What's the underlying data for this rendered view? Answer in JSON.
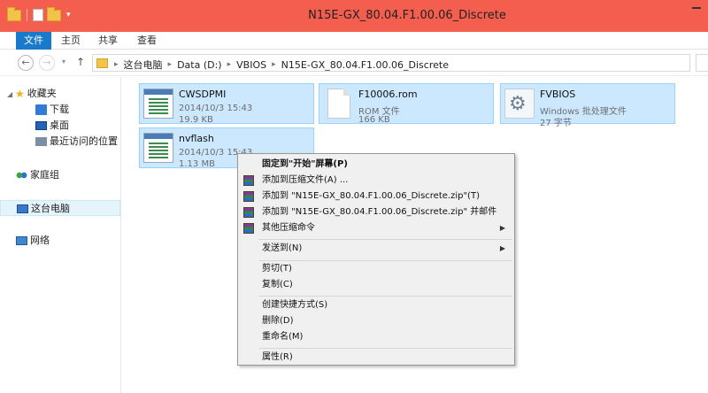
{
  "window": {
    "title": "N15E-GX_80.04.F1.00.06_Discrete"
  },
  "ribbon": {
    "tabs": [
      {
        "label": "文件",
        "active": true
      },
      {
        "label": "主页"
      },
      {
        "label": "共享"
      },
      {
        "label": "查看"
      }
    ]
  },
  "address": {
    "crumbs": [
      "这台电脑",
      "Data (D:)",
      "VBIOS",
      "N15E-GX_80.04.F1.00.06_Discrete"
    ]
  },
  "sidebar": {
    "favorites": "收藏夹",
    "downloads": "下载",
    "desktop": "桌面",
    "recent": "最近访问的位置",
    "homegroup": "家庭组",
    "this_pc": "这台电脑",
    "network": "网络"
  },
  "files": [
    {
      "name": "CWSDPMI",
      "line1": "2014/10/3 15:43",
      "line2": "19.9 KB",
      "icon": "exe-icon"
    },
    {
      "name": "F10006.rom",
      "line1": "ROM 文件",
      "line2": "166 KB",
      "icon": "rom-file-icon"
    },
    {
      "name": "FVBIOS",
      "line1": "Windows 批处理文件",
      "line2": "27 字节",
      "icon": "batch-file-icon"
    },
    {
      "name": "nvflash",
      "line1": "2014/10/3 15:43",
      "line2": "1.13 MB",
      "icon": "exe-icon"
    }
  ],
  "context_menu": {
    "items": [
      {
        "label": "固定到\"开始\"屏幕(P)",
        "bold": true
      },
      {
        "label": "添加到压缩文件(A) ...",
        "icon": "winrar-icon"
      },
      {
        "label": "添加到 \"N15E-GX_80.04.F1.00.06_Discrete.zip\"(T)",
        "icon": "winrar-icon"
      },
      {
        "label": "添加到 \"N15E-GX_80.04.F1.00.06_Discrete.zip\" 并邮件",
        "icon": "winrar-icon"
      },
      {
        "label": "其他压缩命令",
        "icon": "winrar-icon",
        "submenu": true
      },
      {
        "label": "发送到(N)",
        "submenu": true
      },
      {
        "label": "剪切(T)"
      },
      {
        "label": "复制(C)"
      },
      {
        "label": "创建快捷方式(S)"
      },
      {
        "label": "删除(D)"
      },
      {
        "label": "重命名(M)"
      },
      {
        "label": "属性(R)"
      }
    ]
  },
  "colors": {
    "titlebar": "#f35e4f",
    "active_tab": "#1979ca",
    "selection": "#cce8ff",
    "selection_border": "#99d1ff"
  }
}
